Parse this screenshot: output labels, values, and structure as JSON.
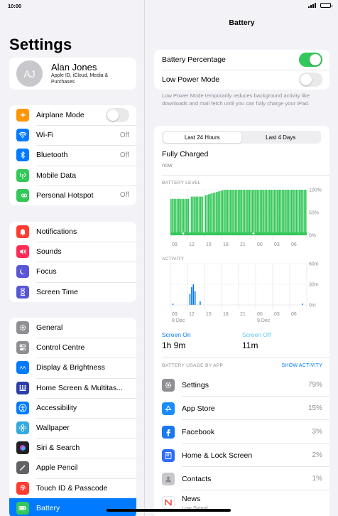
{
  "status": {
    "time": "10:00"
  },
  "sidebar": {
    "title": "Settings",
    "profile": {
      "initials": "AJ",
      "name": "Alan Jones",
      "subtitle": "Apple ID, iCloud, Media & Purchases"
    },
    "group1": [
      {
        "label": "Airplane Mode",
        "icon": "airplane-icon",
        "color": "#ff9500",
        "toggle": false
      },
      {
        "label": "Wi-Fi",
        "icon": "wifi-icon",
        "color": "#007aff",
        "value": "Off"
      },
      {
        "label": "Bluetooth",
        "icon": "bluetooth-icon",
        "color": "#007aff",
        "value": "Off"
      },
      {
        "label": "Mobile Data",
        "icon": "antenna-icon",
        "color": "#34c759"
      },
      {
        "label": "Personal Hotspot",
        "icon": "hotspot-icon",
        "color": "#34c759",
        "value": "Off"
      }
    ],
    "group2": [
      {
        "label": "Notifications",
        "icon": "bell-icon",
        "color": "#ff3b30"
      },
      {
        "label": "Sounds",
        "icon": "speaker-icon",
        "color": "#ff2d55"
      },
      {
        "label": "Focus",
        "icon": "moon-icon",
        "color": "#5856d6"
      },
      {
        "label": "Screen Time",
        "icon": "hourglass-icon",
        "color": "#5856d6"
      }
    ],
    "group3": [
      {
        "label": "General",
        "icon": "gear-icon",
        "color": "#8e8e93"
      },
      {
        "label": "Control Centre",
        "icon": "switches-icon",
        "color": "#8e8e93"
      },
      {
        "label": "Display & Brightness",
        "icon": "aa-icon",
        "color": "#007aff"
      },
      {
        "label": "Home Screen & Multitas...",
        "icon": "grid-icon",
        "color": "#2c3ea8"
      },
      {
        "label": "Accessibility",
        "icon": "accessibility-icon",
        "color": "#007aff"
      },
      {
        "label": "Wallpaper",
        "icon": "flower-icon",
        "color": "#34aadc"
      },
      {
        "label": "Siri & Search",
        "icon": "siri-icon",
        "color": "#222222"
      },
      {
        "label": "Apple Pencil",
        "icon": "pencil-icon",
        "color": "#636366"
      },
      {
        "label": "Touch ID & Passcode",
        "icon": "fingerprint-icon",
        "color": "#ff3b30"
      },
      {
        "label": "Battery",
        "icon": "battery-icon",
        "color": "#34c759",
        "active": true
      }
    ]
  },
  "main": {
    "title": "Battery",
    "battery_percentage_label": "Battery Percentage",
    "battery_percentage_on": true,
    "low_power_label": "Low Power Mode",
    "low_power_on": false,
    "low_power_note": "Low Power Mode temporarily reduces background activity like downloads and mail fetch until you can fully charge your iPad.",
    "tabs": [
      "Last 24 Hours",
      "Last 4 Days"
    ],
    "selected_tab": 0,
    "charge_status": "Fully Charged",
    "charge_time": "now",
    "battery_level_label": "BATTERY LEVEL",
    "activity_label": "ACTIVITY",
    "screen_on_label": "Screen On",
    "screen_on_value": "1h 9m",
    "screen_off_label": "Screen Off",
    "screen_off_value": "11m",
    "usage_header": "BATTERY USAGE BY APP",
    "show_activity": "SHOW ACTIVITY",
    "apps": [
      {
        "name": "Settings",
        "pct": "79%",
        "icon": "gear-icon",
        "color": "#8e8e93"
      },
      {
        "name": "App Store",
        "pct": "15%",
        "icon": "appstore-icon",
        "color": "#1a8cff"
      },
      {
        "name": "Facebook",
        "pct": "3%",
        "icon": "facebook-icon",
        "color": "#1877f2"
      },
      {
        "name": "Home & Lock Screen",
        "pct": "2%",
        "icon": "home-lock-icon",
        "color": "#2f6df6"
      },
      {
        "name": "Contacts",
        "pct": "1%",
        "icon": "contacts-icon",
        "color": "#c8c7cc"
      },
      {
        "name": "News",
        "sub": "Low Signal",
        "icon": "news-icon",
        "color": "#ffffff"
      }
    ]
  },
  "chart_data": [
    {
      "type": "area",
      "title": "BATTERY LEVEL",
      "x_ticks": [
        "09",
        "12",
        "15",
        "18",
        "21",
        "00",
        "03",
        "06"
      ],
      "y_ticks": [
        "100%",
        "50%",
        "0%"
      ],
      "ylim": [
        0,
        100
      ],
      "values": [
        80,
        80,
        80,
        80,
        80,
        80,
        80,
        80,
        80,
        80,
        80,
        80,
        0,
        85,
        85,
        85,
        85,
        85,
        85,
        85,
        85,
        0,
        88,
        89,
        90,
        91,
        92,
        93,
        94,
        95,
        96,
        97,
        98,
        99,
        100,
        100,
        100,
        100,
        100,
        100,
        100,
        100,
        100,
        100,
        100,
        100,
        100,
        100,
        100,
        100,
        100,
        100,
        100,
        100,
        100,
        100,
        100,
        100,
        100,
        100,
        100,
        100,
        100,
        100,
        100,
        100,
        100,
        100,
        100,
        100,
        100,
        100,
        100,
        100,
        100,
        100,
        100,
        100,
        100,
        100,
        100,
        100,
        100,
        100,
        100,
        100,
        100
      ],
      "color": "#34c759"
    },
    {
      "type": "bar",
      "title": "ACTIVITY",
      "x_ticks": [
        "09",
        "12",
        "15",
        "18",
        "21",
        "00",
        "03",
        "06"
      ],
      "date_labels": [
        "8 Dec",
        "9 Dec"
      ],
      "y_ticks": [
        "60m",
        "30m",
        "0m"
      ],
      "ylim": [
        0,
        60
      ],
      "values": [
        0,
        2,
        0,
        0,
        0,
        0,
        0,
        0,
        0,
        0,
        0,
        16,
        26,
        30,
        20,
        0,
        0,
        5,
        0,
        0,
        0,
        0,
        0,
        0,
        0,
        0,
        0,
        0,
        0,
        0,
        0,
        0,
        0,
        0,
        0,
        0,
        0,
        0,
        0,
        0,
        0,
        0,
        0,
        0,
        0,
        0,
        0,
        0,
        0,
        0,
        0,
        0,
        0,
        0,
        0,
        0,
        0,
        0,
        0,
        0,
        0,
        0,
        0,
        0,
        0,
        0,
        0,
        0,
        0,
        0,
        0,
        0,
        0,
        0,
        0,
        0,
        0,
        2,
        0,
        0
      ],
      "color": "#007aff"
    }
  ]
}
